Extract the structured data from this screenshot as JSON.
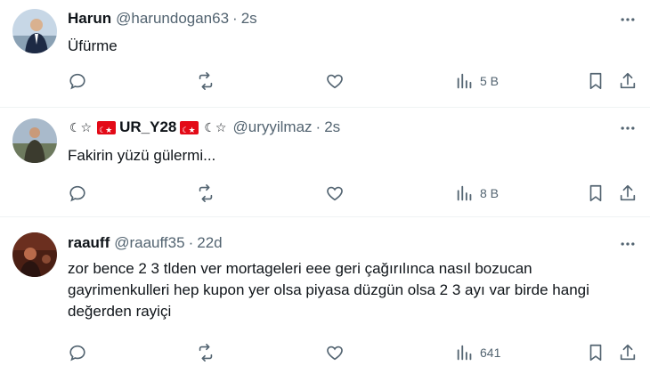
{
  "tweets": [
    {
      "name": "Harun",
      "handle": "@harundogan63",
      "dot": "·",
      "time": "2s",
      "text": "Üfürme",
      "views": "5 B",
      "avatar_colors": [
        "#c7d7e6",
        "#1d2a44"
      ]
    },
    {
      "name_prefix": "☾☆",
      "name": "UR_Y28",
      "name_suffix": "☾☆",
      "handle": "@uryyilmaz",
      "dot": "·",
      "time": "2s",
      "text": "Fakirin yüzü gülermi...",
      "views": "8 B",
      "avatar_colors": [
        "#8fa3b8",
        "#3b3b2e"
      ]
    },
    {
      "name": "raauff",
      "handle": "@raauff35",
      "dot": "·",
      "time": "22d",
      "text": "zor bence 2 3 tlden ver mortageleri eee geri çağırılınca nasıl bozucan gayrimenkulleri hep kupon yer olsa piyasa düzgün olsa 2 3 ayı var birde hangi değerden rayiçi",
      "views": "641",
      "avatar_colors": [
        "#4a1f14",
        "#b86a4a"
      ]
    }
  ],
  "icons": {
    "more": "more-icon",
    "reply": "reply-icon",
    "retweet": "retweet-icon",
    "like": "like-icon",
    "views": "views-icon",
    "bookmark": "bookmark-icon",
    "share": "share-icon"
  },
  "colors": {
    "text": "#0f1419",
    "secondary": "#536471",
    "divider": "#eff3f4",
    "flag": "#e30a17"
  }
}
